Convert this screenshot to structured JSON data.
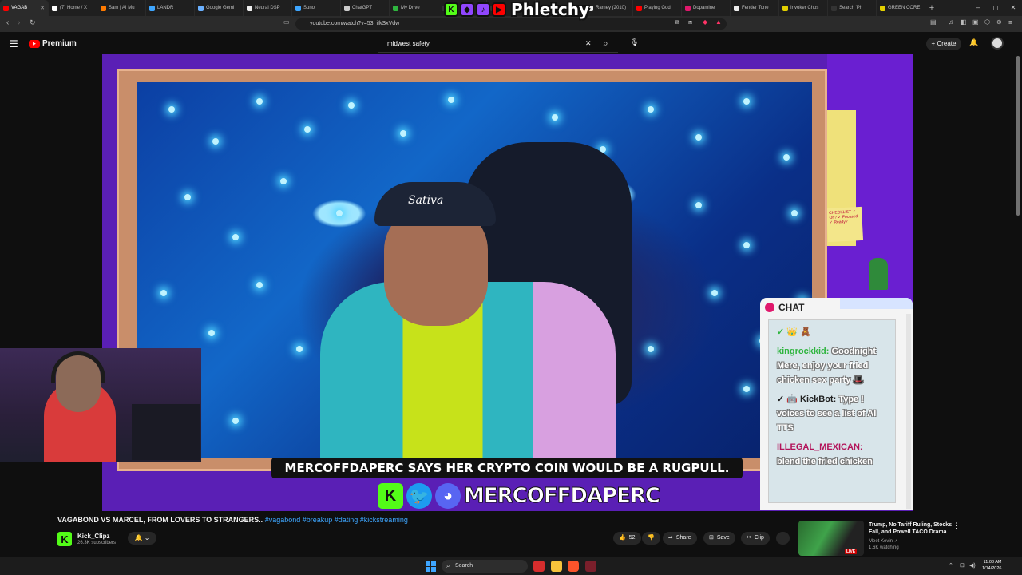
{
  "browser": {
    "tabs": [
      {
        "label": "VAGAB",
        "color": "#ff0000",
        "active": true
      },
      {
        "label": "(7) Home / X",
        "color": "#ffffff",
        "active": false
      },
      {
        "label": "Sam | AI Mu",
        "color": "#ff7a00",
        "active": false
      },
      {
        "label": "LANDR",
        "color": "#3ea6ff",
        "active": false
      },
      {
        "label": "Google Gemi",
        "color": "#6ab0ff",
        "active": false
      },
      {
        "label": "Neural DSP",
        "color": "#eeeeee",
        "active": false
      },
      {
        "label": "Suno",
        "color": "#3ea6ff",
        "active": false
      },
      {
        "label": "ChatGPT",
        "color": "#cccccc",
        "active": false
      },
      {
        "label": "My Drive",
        "color": "#2fb53f",
        "active": false
      },
      {
        "label": "",
        "color": "#333333",
        "active": false
      },
      {
        "label": "",
        "color": "#333333",
        "active": false
      },
      {
        "label": "",
        "color": "#333333",
        "active": false
      },
      {
        "label": "Ramey (2010)",
        "color": "#eeeeee",
        "active": false
      },
      {
        "label": "Playing God",
        "color": "#ff0000",
        "active": false
      },
      {
        "label": "Dopamine",
        "color": "#e0186c",
        "active": false
      },
      {
        "label": "Fender Tone",
        "color": "#eeeeee",
        "active": false
      },
      {
        "label": "Invoker Chos",
        "color": "#e3d000",
        "active": false
      },
      {
        "label": "Search 'Ph",
        "color": "#333333",
        "active": false
      },
      {
        "label": "GREEN CORE",
        "color": "#e3d000",
        "active": false
      }
    ],
    "new_tab_icon": "+",
    "window_controls": [
      "–",
      "◻",
      "✕"
    ],
    "url": "youtube.com/watch?v=53_iIkSxVdw"
  },
  "overlay_brand": {
    "text": "Phletchy",
    "badges": [
      {
        "letter": "K",
        "color": "#53fc18"
      },
      {
        "letter": "◆",
        "color": "#9146ff"
      },
      {
        "letter": "♪",
        "color": "#9146ff"
      },
      {
        "letter": "▶",
        "color": "#ff0000"
      }
    ]
  },
  "youtube": {
    "logo_text": "Premium",
    "search_query": "midwest safety",
    "clear_icon": "✕",
    "search_icon": "⌕",
    "mic_icon": "🎙",
    "create_label": "+ Create",
    "notification_icon": "🔔"
  },
  "video": {
    "hat_text": "Sativa",
    "sticky_note": "CHECKLIST ✓ On? ✓ Focused ✓ Ready?",
    "caption": "MERCOFFDAPERC SAYS HER CRYPTO COIN WOULD BE A RUGPULL.",
    "handle": "MERCOFFDAPERC",
    "chat": {
      "title": "CHAT",
      "messages": [
        {
          "user": "✓ 👑 🧸",
          "text": "",
          "style": "badges"
        },
        {
          "user": "kingrockkid:",
          "text": "Goodnight Mere, enjoy your fried chicken sex party 🎩",
          "style": "green"
        },
        {
          "user": "✓ 🤖 KickBot:",
          "text": "Type ! voices to see a list of AI TTS",
          "style": "bot"
        },
        {
          "user": "ILLEGAL_MEXICAN:",
          "text": "blend the fried chicken",
          "style": "red"
        }
      ]
    }
  },
  "below_video": {
    "title": "VAGABOND VS MARCEL, FROM LOVERS TO STRANGERS..",
    "tags": "#vagabond #breakup #dating #kickstreaming",
    "channel_name": "Kick_Clipz",
    "channel_logo": "K",
    "subscribers": "26.3K subscribers",
    "bell_icon": "🔔 ⌄",
    "like_count": "52",
    "like_icon": "👍",
    "dislike_icon": "👎",
    "share_label": "Share",
    "save_label": "Save",
    "clip_label": "Clip",
    "more_icon": "⋯"
  },
  "recommendation": {
    "title": "Trump, No Tariff Ruling, Stocks Fall, and Powell TACO Drama",
    "channel": "Meet Kevin ✓",
    "watching": "1.6K watching",
    "live_badge": "LIVE",
    "more_icon": "⋮"
  },
  "taskbar": {
    "search_placeholder": "Search",
    "time": "11:08 AM",
    "date": "1/14/2026"
  }
}
